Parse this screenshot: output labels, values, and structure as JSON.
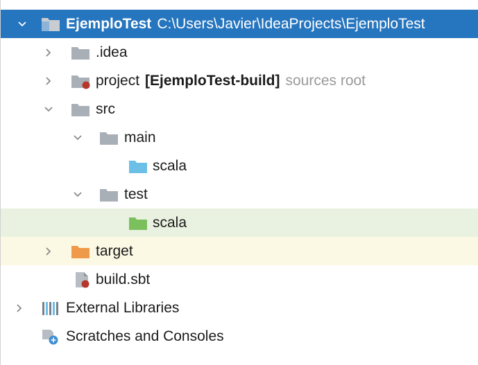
{
  "project_tree": {
    "root": {
      "name": "EjemploTest",
      "path": "C:\\Users\\Javier\\IdeaProjects\\EjemploTest",
      "icon": "project-folder-icon",
      "expanded": true
    },
    "idea": {
      "name": ".idea",
      "icon": "folder-icon",
      "expanded": false
    },
    "project": {
      "name": "project",
      "module": "[EjemploTest-build]",
      "hint": "sources root",
      "icon": "sbt-module-folder-icon",
      "expanded": false
    },
    "src": {
      "name": "src",
      "icon": "folder-icon",
      "expanded": true
    },
    "main": {
      "name": "main",
      "icon": "folder-icon",
      "expanded": true
    },
    "main_scala": {
      "name": "scala",
      "icon": "sources-root-folder-icon"
    },
    "test": {
      "name": "test",
      "icon": "folder-icon",
      "expanded": true
    },
    "test_scala": {
      "name": "scala",
      "icon": "test-sources-root-folder-icon"
    },
    "target": {
      "name": "target",
      "icon": "excluded-folder-icon",
      "expanded": false
    },
    "build_sbt": {
      "name": "build.sbt",
      "icon": "sbt-file-icon"
    },
    "external_libraries": {
      "name": "External Libraries",
      "icon": "libraries-icon",
      "expanded": false
    },
    "scratches": {
      "name": "Scratches and Consoles",
      "icon": "scratches-icon"
    }
  },
  "colors": {
    "selection": "#2675bf",
    "test_root_bg": "#e9f2e0",
    "excluded_bg": "#fbf9e4",
    "folder_gray": "#a9afb6",
    "sources_blue": "#6cc0e8",
    "test_green": "#7cc05e",
    "excluded_orange": "#ef9a4a",
    "sbt_red": "#b5372c"
  }
}
